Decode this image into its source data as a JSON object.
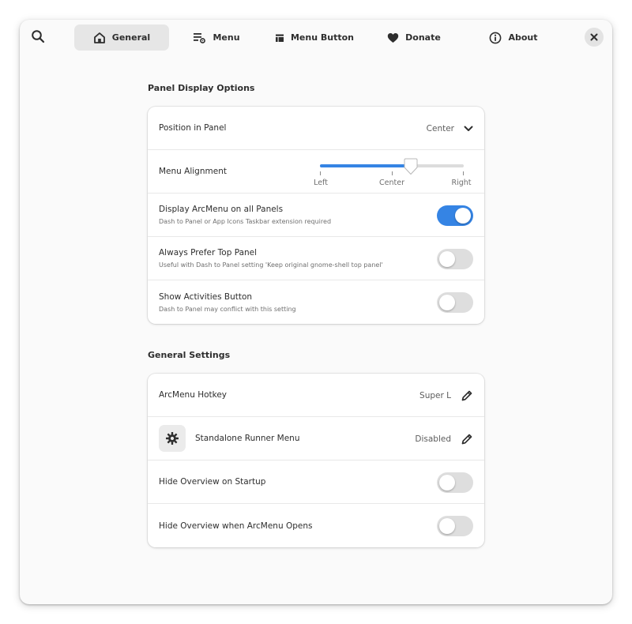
{
  "header": {
    "tabs": [
      {
        "label": "General",
        "icon": "home-icon",
        "active": true
      },
      {
        "label": "Menu",
        "icon": "menu-settings-icon",
        "active": false
      },
      {
        "label": "Menu Button",
        "icon": "menu-button-icon",
        "active": false
      },
      {
        "label": "Donate",
        "icon": "heart-icon",
        "active": false
      },
      {
        "label": "About",
        "icon": "info-icon",
        "active": false
      }
    ]
  },
  "panel_display": {
    "title": "Panel Display Options",
    "position": {
      "label": "Position in Panel",
      "value": "Center"
    },
    "alignment": {
      "label": "Menu Alignment",
      "marks": [
        "Left",
        "Center",
        "Right"
      ],
      "value_fraction": 0.63
    },
    "display_all_panels": {
      "label": "Display ArcMenu on all Panels",
      "subtitle": "Dash to Panel or App Icons Taskbar extension required",
      "enabled": true
    },
    "prefer_top_panel": {
      "label": "Always Prefer Top Panel",
      "subtitle": "Useful with Dash to Panel setting 'Keep original gnome-shell top panel'",
      "enabled": false
    },
    "activities_button": {
      "label": "Show Activities Button",
      "subtitle": "Dash to Panel may conflict with this setting",
      "enabled": false
    }
  },
  "general_settings": {
    "title": "General Settings",
    "hotkey": {
      "label": "ArcMenu Hotkey",
      "value": "Super L"
    },
    "runner": {
      "label": "Standalone Runner Menu",
      "value": "Disabled"
    },
    "hide_overview_startup": {
      "label": "Hide Overview on Startup",
      "enabled": false
    },
    "hide_overview_open": {
      "label": "Hide Overview when ArcMenu Opens",
      "enabled": false
    }
  },
  "colors": {
    "accent": "#3584e4"
  }
}
